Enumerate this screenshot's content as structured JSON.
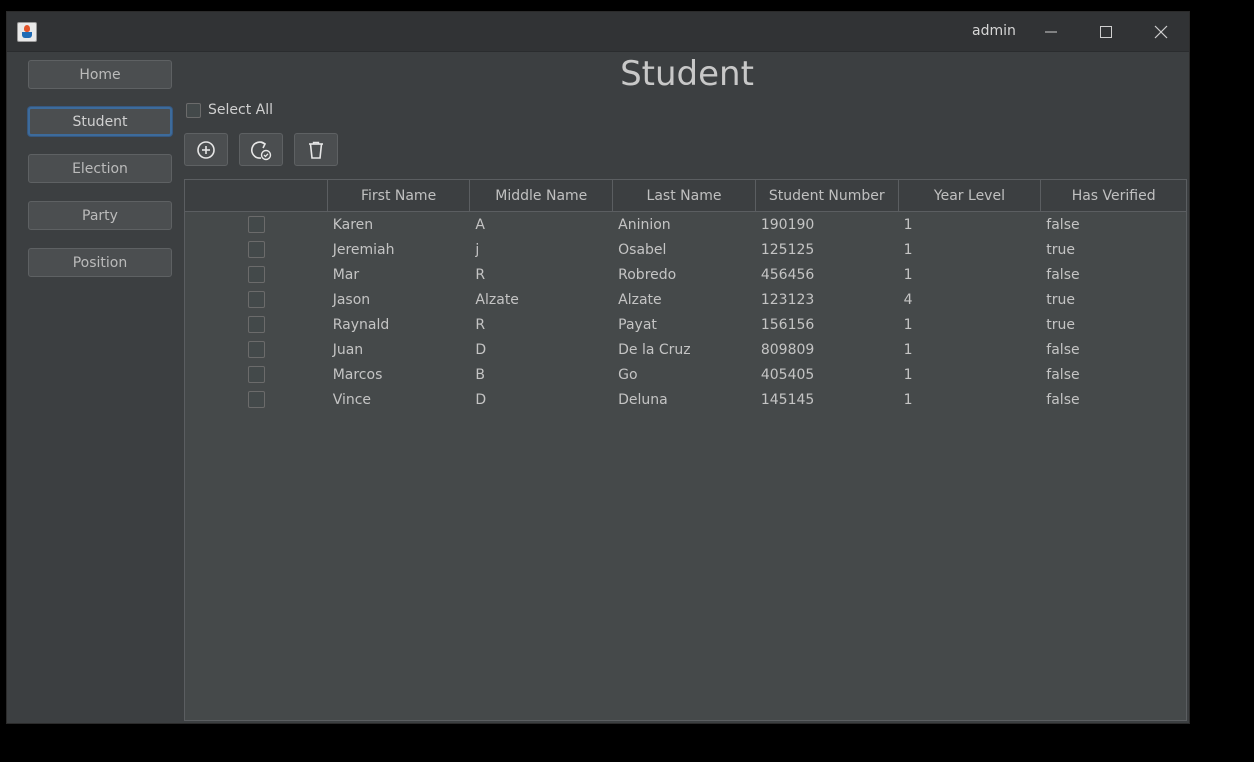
{
  "window": {
    "user": "admin"
  },
  "sidebar": {
    "items": [
      {
        "label": "Home"
      },
      {
        "label": "Student"
      },
      {
        "label": "Election"
      },
      {
        "label": "Party"
      },
      {
        "label": "Position"
      }
    ],
    "active": "Student"
  },
  "main": {
    "title": "Student",
    "select_all_label": "Select All",
    "toolbar": {
      "add_icon": "plus-circle-icon",
      "refresh_icon": "refresh-check-icon",
      "delete_icon": "trash-icon"
    }
  },
  "table": {
    "columns": [
      "",
      "First Name",
      "Middle Name",
      "Last Name",
      "Student Number",
      "Year Level",
      "Has Verified"
    ],
    "rows": [
      [
        "Karen",
        "A",
        "Aninion",
        "190190",
        "1",
        "false"
      ],
      [
        "Jeremiah",
        "j",
        "Osabel",
        "125125",
        "1",
        "true"
      ],
      [
        "Mar",
        "R",
        "Robredo",
        "456456",
        "1",
        "false"
      ],
      [
        "Jason",
        "Alzate",
        "Alzate",
        "123123",
        "4",
        "true"
      ],
      [
        "Raynald",
        "R",
        "Payat",
        "156156",
        "1",
        "true"
      ],
      [
        "Juan",
        "D",
        "De la Cruz",
        "809809",
        "1",
        "false"
      ],
      [
        "Marcos",
        "B",
        "Go",
        "405405",
        "1",
        "false"
      ],
      [
        "Vince",
        "D",
        "Deluna",
        "145145",
        "1",
        "false"
      ]
    ]
  },
  "colors": {
    "background": "#3c3f41",
    "titlebar": "#313335",
    "table_bg": "#45494a",
    "accent": "#3d6b9b"
  }
}
